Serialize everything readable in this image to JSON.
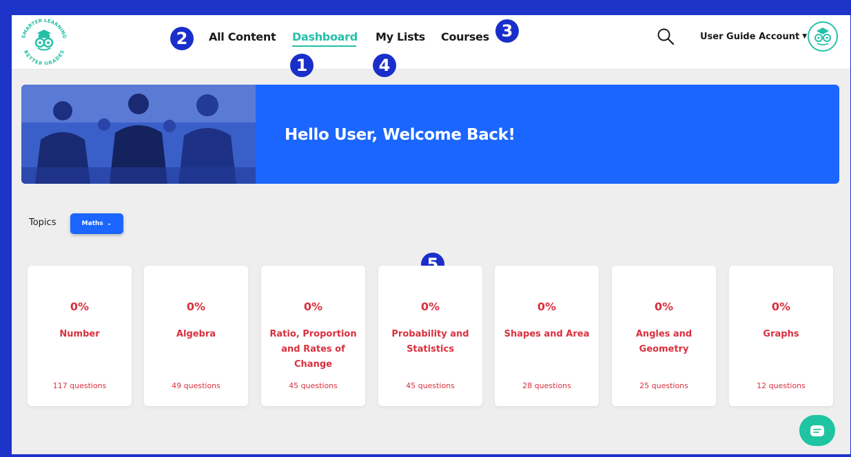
{
  "logo": {
    "top_text": "SMARTER LEARNING",
    "bottom_text": "BETTER GRADES"
  },
  "nav": {
    "all_content": "All Content",
    "dashboard": "Dashboard",
    "my_lists": "My Lists",
    "courses": "Courses"
  },
  "badges": [
    "1",
    "2",
    "3",
    "4",
    "5"
  ],
  "header": {
    "account_label": "User Guide Account",
    "icons": [
      "search-icon",
      "caret-down-icon",
      "owl-avatar-icon"
    ]
  },
  "banner": {
    "title": "Hello User, Welcome Back!"
  },
  "topics": {
    "label": "Topics",
    "selected": "Maths"
  },
  "cards": [
    {
      "percent": "0%",
      "name": "Number",
      "count": "117 questions"
    },
    {
      "percent": "0%",
      "name": "Algebra",
      "count": "49 questions"
    },
    {
      "percent": "0%",
      "name": "Ratio, Proportion and Rates of Change",
      "count": "45 questions"
    },
    {
      "percent": "0%",
      "name": "Probability and Statistics",
      "count": "45 questions"
    },
    {
      "percent": "0%",
      "name": "Shapes and Area",
      "count": "28 questions"
    },
    {
      "percent": "0%",
      "name": "Angles and Geometry",
      "count": "25 questions"
    },
    {
      "percent": "0%",
      "name": "Graphs",
      "count": "12 questions"
    }
  ],
  "colors": {
    "brand_blue": "#1a66ff",
    "frame_blue": "#1e34c8",
    "teal": "#26c0a8",
    "card_text_red": "#d9303e"
  }
}
